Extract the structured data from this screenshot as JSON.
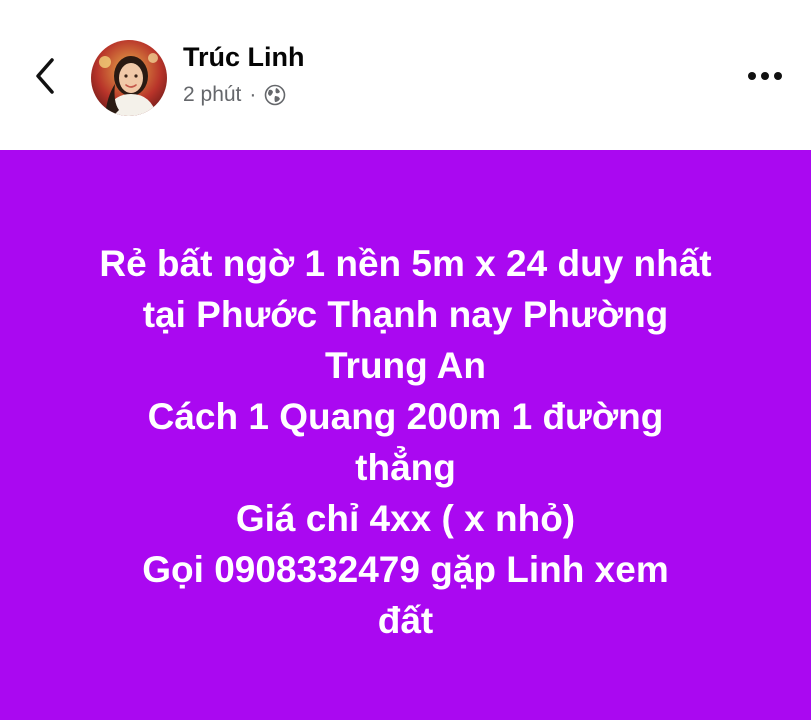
{
  "post": {
    "author": "Trúc Linh",
    "time": "2 phút",
    "separator": "·",
    "privacy_icon": "globe-icon",
    "lines": [
      "Rẻ bất ngờ 1 nền 5m x 24 duy nhất",
      "tại Phước Thạnh nay  Phường",
      "Trung An",
      "Cách 1 Quang 200m 1 đường",
      "thẳng",
      "Giá chỉ 4xx ( x nhỏ)",
      "Gọi 0908332479 gặp Linh xem",
      "đất"
    ]
  },
  "icons": {
    "back": "chevron-left-icon",
    "more": "more-horizontal-icon"
  },
  "colors": {
    "post_background": "#aa08f1",
    "post_text": "#ffffff",
    "name_text": "#050505",
    "meta_text": "#65676b"
  }
}
